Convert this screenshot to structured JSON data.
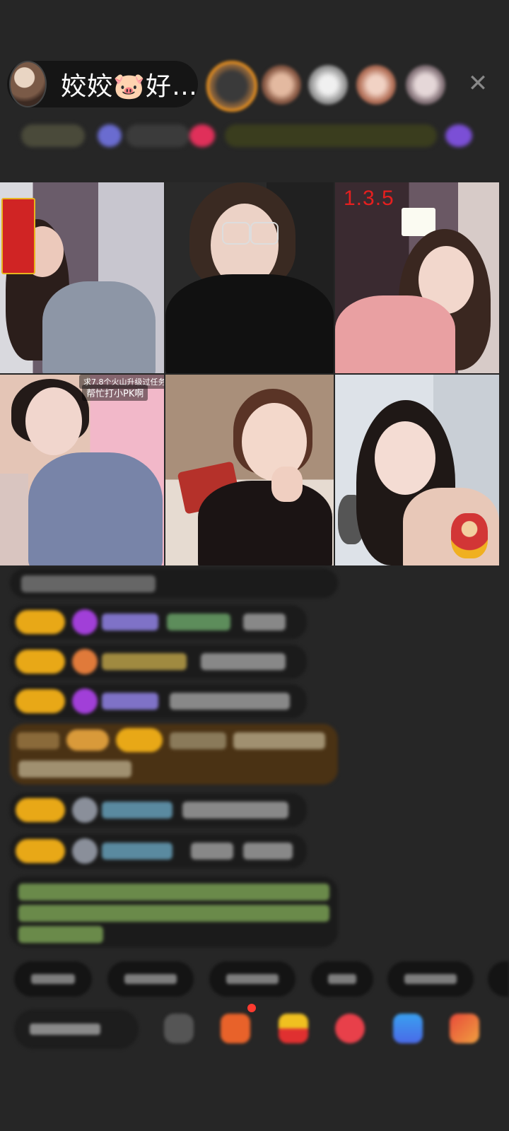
{
  "header": {
    "host_name": "姣姣🐷好…"
  },
  "video_grid": {
    "tile_1": {},
    "tile_4": {
      "caption_line1": "求7.8个火山升级过任务",
      "caption_line2": "帮忙打小PK啊"
    },
    "tile_3": {
      "counter": "1.3.5"
    }
  },
  "colors": {
    "background": "#262626",
    "badge_gold": "#e8a817",
    "counter_red": "#e61f1f",
    "viewer_ring": "#e8901f"
  }
}
